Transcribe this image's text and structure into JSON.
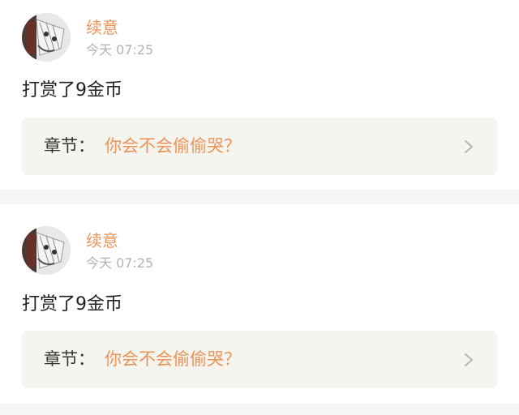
{
  "feed": {
    "items": [
      {
        "username": "续意",
        "time": "今天 07:25",
        "message": "打赏了9金币",
        "chapter_label": "章节：",
        "chapter_title": "你会不会偷偷哭？",
        "chevron_icon": "chevron-right-icon",
        "avatar_icon": "avatar-image"
      },
      {
        "username": "续意",
        "time": "今天 07:25",
        "message": "打赏了9金币",
        "chapter_label": "章节：",
        "chapter_title": "你会不会偷偷哭？",
        "chevron_icon": "chevron-right-icon",
        "avatar_icon": "avatar-image"
      }
    ]
  },
  "colors": {
    "accent": "#e9955a",
    "text": "#222222",
    "muted": "#b3b3b3",
    "chapter_bg": "#f5f4ef",
    "separator": "#f5f5f5"
  }
}
